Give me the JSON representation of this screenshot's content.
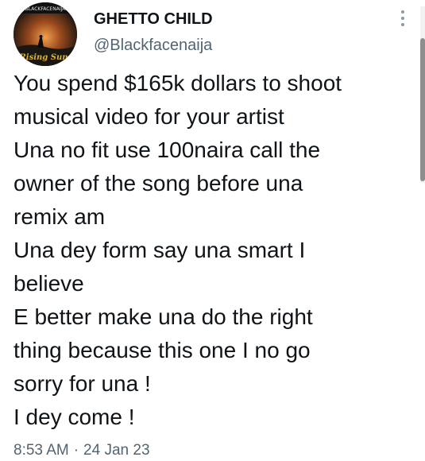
{
  "user": {
    "display_name": "GHETTO CHILD",
    "handle": "@Blackfacenaija"
  },
  "avatar": {
    "banner_text": "BLACKFACENAIJA",
    "logo_text": "Rising Sun",
    "colors": {
      "sky": "#3a2a1c",
      "sun": "#d9732b",
      "logo": "#c9a227"
    }
  },
  "tweet": {
    "lines": [
      "You spend $165k dollars to shoot",
      "musical video for your artist",
      "Una no fit use 100naira call the",
      "owner of the song before una",
      "remix am",
      "Una dey form say una smart I",
      "believe",
      "E better make una do the right",
      "thing because this one I no go",
      "sorry for una !",
      "I dey come !"
    ]
  },
  "meta": {
    "time": "8:53 AM",
    "separator": "·",
    "date": "24 Jan 23"
  },
  "icons": {
    "more": "more-vertical-icon"
  },
  "colors": {
    "text": "#0f1419",
    "secondary": "#536471",
    "background": "#ffffff"
  }
}
